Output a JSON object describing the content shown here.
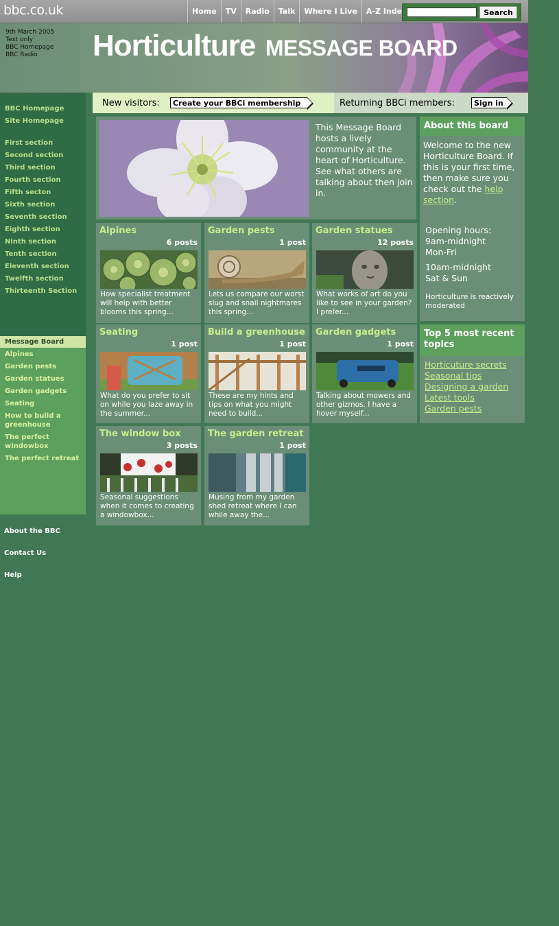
{
  "header": {
    "logo": "bbc.co.uk",
    "nav": [
      "Home",
      "TV",
      "Radio",
      "Talk",
      "Where I Live",
      "A-Z Index"
    ],
    "search_button": "Search",
    "search_value": ""
  },
  "banner": {
    "date": "9th March 2005",
    "links": [
      "Text only",
      "BBC Homepage",
      "BBC Radio"
    ],
    "title_main": "Horticulture",
    "title_sub": "MESSAGE BOARD"
  },
  "leftnav": {
    "top_links": [
      "BBC Homepage",
      "Site Homepage"
    ],
    "sections": [
      "First section",
      "Second section",
      "Third section",
      "Fourth section",
      "Fifth secton",
      "Sixth section",
      "Seventh section",
      "Eighth section",
      "Ninth section",
      "Tenth section",
      "Eleventh section",
      "Twelfth section",
      "Thirteenth Section"
    ],
    "message_board": "Message Board",
    "board_links": [
      "Alpines",
      "Garden pests",
      "Garden statues",
      "Garden gadgets",
      "Seating",
      "How to build a greenhouse",
      "The perfect windowbox",
      "The perfect retreat"
    ],
    "footer_links": [
      "About the BBC",
      "Contact Us",
      "Help"
    ]
  },
  "login": {
    "new_label": "New visitors:",
    "new_button": "Create your BBCi membership",
    "return_label": "Returning BBCi members:",
    "return_button": "Sign in"
  },
  "intro": {
    "text": "This Message Board hosts a lively community at the heart of Horticulture. See what others are talking about then join in."
  },
  "cards": [
    {
      "title": "Alpines",
      "posts": "6 posts",
      "desc": "How specialist treatment will help with better blooms this spring...",
      "image": "succulent-rosette"
    },
    {
      "title": "Garden pests",
      "posts": "1 post",
      "desc": "Lets us compare our worst slug and snail nightmares this spring...",
      "image": "snail"
    },
    {
      "title": "Garden statues",
      "posts": "12 posts",
      "desc": "What works of art do you like to see in your garden? I prefer...",
      "image": "stone-face"
    },
    {
      "title": "Seating",
      "posts": "1 post",
      "desc": "What do you prefer to sit on while you laze away in the summer...",
      "image": "blue-bench"
    },
    {
      "title": "Build a greenhouse",
      "posts": "1 post",
      "desc": "These are my hints and tips on what you might need to build...",
      "image": "timber-frame"
    },
    {
      "title": "Garden gadgets",
      "posts": "1 post",
      "desc": "Talking about mowers and other gizmos. I have a hover myself...",
      "image": "lawnmower"
    },
    {
      "title": "The window box",
      "posts": "3 posts",
      "desc": "Seasonal suggestions when it comes to creating a windowbox...",
      "image": "window-box"
    },
    {
      "title": "The garden retreat",
      "posts": "1 post",
      "desc": "Musing from my garden shed retreat where I can while away the...",
      "image": "shed"
    }
  ],
  "about": {
    "heading": "About this board",
    "welcome": "Welcome to the new Horticulture Board. If this is your first time, then make sure you check out the",
    "help_link": "help section",
    "hours_label": "Opening hours:",
    "weekday_time": "9am-midnight",
    "weekday_days": "Mon-Fri",
    "weekend_time": "10am-midnight",
    "weekend_days": "Sat & Sun",
    "moderation": "Horticulture is reactively moderated"
  },
  "top5": {
    "heading": "Top 5 most recent topics",
    "topics": [
      "Horticuture secrets",
      "Seasonal tips",
      "Designing a garden",
      "Latest tools",
      "Garden pests"
    ]
  },
  "colors": {
    "page_bg": "#417854",
    "panel": "#6b8e77",
    "accent_green": "#5da05e",
    "link_green": "#c8ee8c"
  }
}
